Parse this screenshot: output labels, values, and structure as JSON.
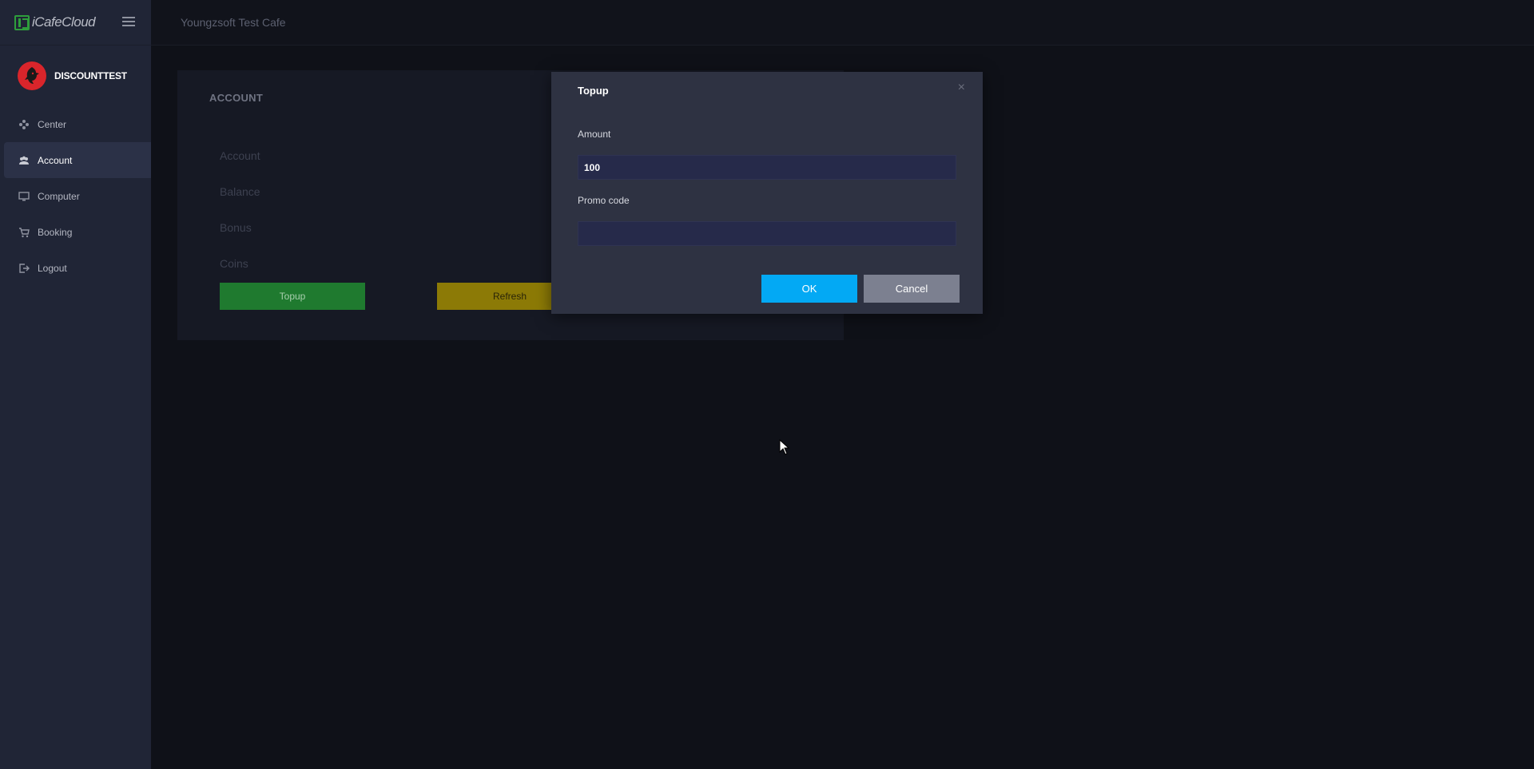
{
  "brand": {
    "name": "iCafeCloud"
  },
  "user": {
    "name": "DISCOUNTTEST"
  },
  "sidebar": {
    "items": [
      {
        "label": "Center",
        "icon": "gamepad-icon"
      },
      {
        "label": "Account",
        "icon": "users-icon",
        "active": true
      },
      {
        "label": "Computer",
        "icon": "monitor-icon"
      },
      {
        "label": "Booking",
        "icon": "cart-icon"
      },
      {
        "label": "Logout",
        "icon": "logout-icon"
      }
    ]
  },
  "header": {
    "cafe_name": "Youngzsoft Test Cafe"
  },
  "account_card": {
    "title": "ACCOUNT",
    "fields": [
      "Account",
      "Balance",
      "Bonus",
      "Coins"
    ],
    "topup_label": "Topup",
    "refresh_label": "Refresh"
  },
  "modal": {
    "title": "Topup",
    "close": "×",
    "amount_label": "Amount",
    "amount_value": "100",
    "promo_label": "Promo code",
    "promo_value": "",
    "ok_label": "OK",
    "cancel_label": "Cancel"
  },
  "colors": {
    "sidebar_bg": "#202536",
    "topup_green": "#1f7a2f",
    "refresh_yellow": "#8c7a06",
    "ok_blue": "#03a9f4",
    "cancel_gray": "#7c8090"
  }
}
